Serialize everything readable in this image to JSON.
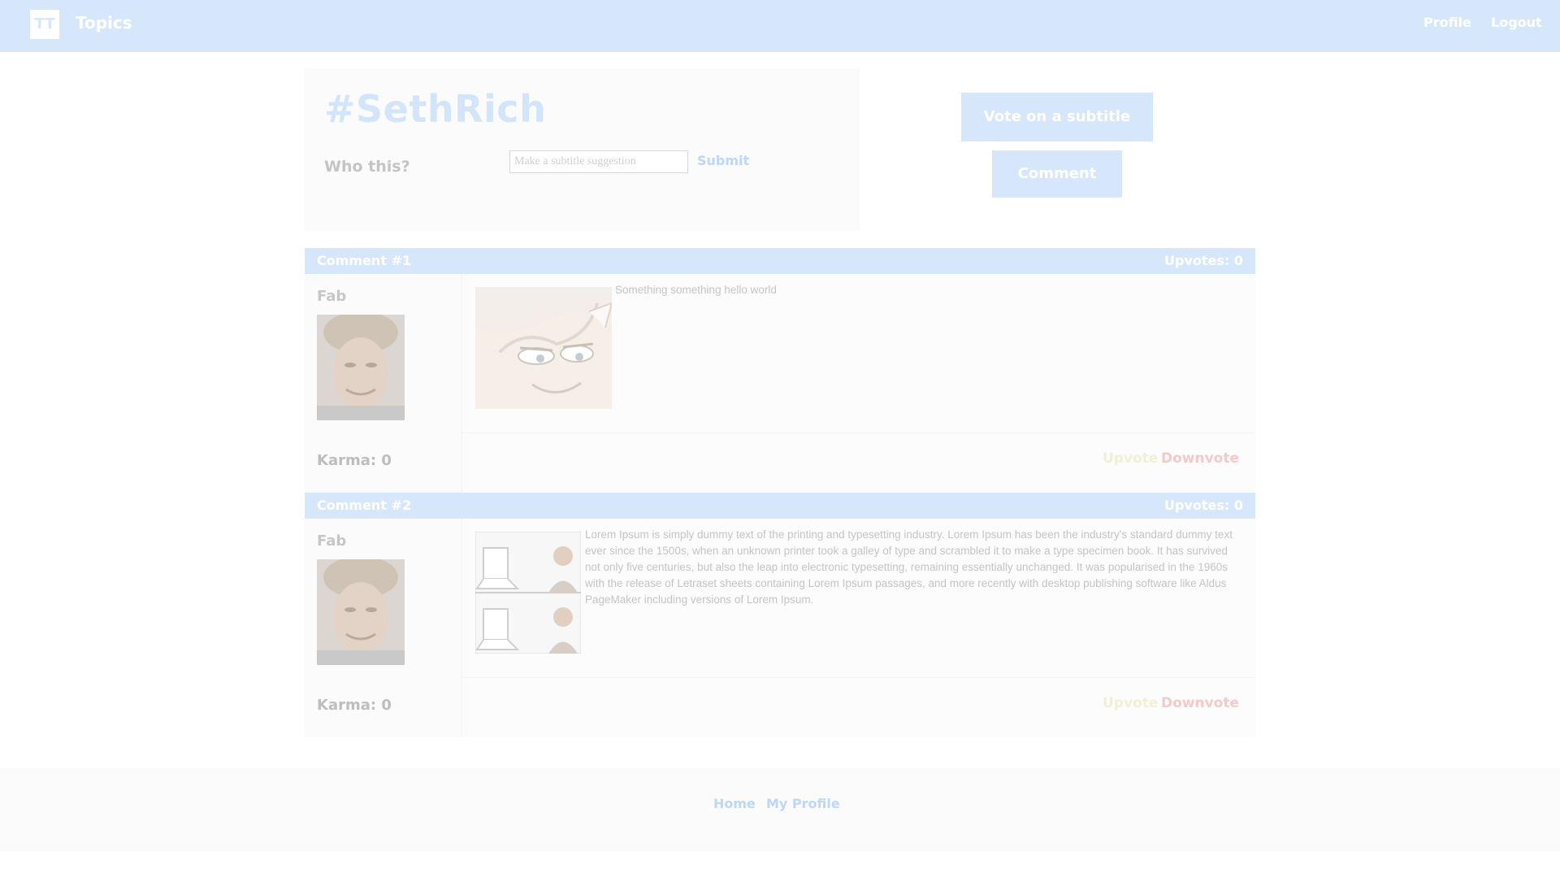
{
  "navbar": {
    "logo_text": "TT",
    "brand": "Topics",
    "links": {
      "profile": "Profile",
      "logout": "Logout"
    }
  },
  "topic": {
    "title": "#SethRich",
    "subtitle": "Who this?",
    "suggestion_placeholder": "Make a subtitle suggestion",
    "submit_label": "Submit"
  },
  "actions": {
    "vote_subtitle_label": "Vote on a subtitle",
    "comment_label": "Comment"
  },
  "comments": [
    {
      "number_label": "Comment #1",
      "upvotes_label": "Upvotes: 0",
      "user": "Fab",
      "karma_label": "Karma: 0",
      "text": "Something something hello world",
      "upvote_label": "Upvote",
      "downvote_label": "Downvote"
    },
    {
      "number_label": "Comment #2",
      "upvotes_label": "Upvotes: 0",
      "user": "Fab",
      "karma_label": "Karma: 0",
      "text": "Lorem Ipsum is simply dummy text of the printing and typesetting industry. Lorem Ipsum has been the industry's standard dummy text ever since the 1500s, when an unknown printer took a galley of type and scrambled it to make a type specimen book. It has survived not only five centuries, but also the leap into electronic typesetting, remaining essentially unchanged. It was popularised in the 1960s with the release of Letraset sheets containing Lorem Ipsum passages, and more recently with desktop publishing software like Aldus PageMaker including versions of Lorem Ipsum.",
      "upvote_label": "Upvote",
      "downvote_label": "Downvote"
    }
  ],
  "footer": {
    "home": "Home",
    "my_profile": "My Profile"
  },
  "colors": {
    "accent": "#d6e7fb",
    "link": "#bcd7f7",
    "upvote": "#f2f0d2",
    "downvote": "#f6c9c9"
  }
}
